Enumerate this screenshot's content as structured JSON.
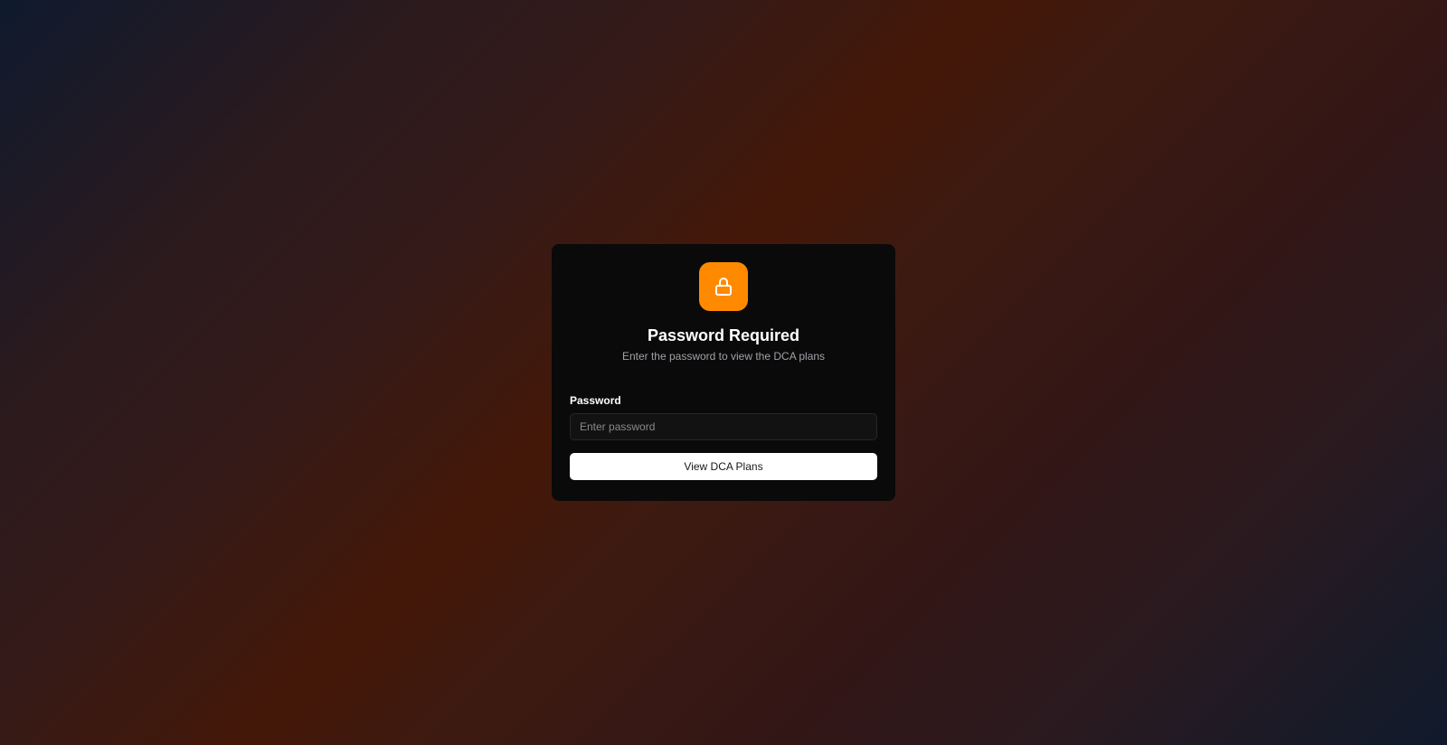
{
  "dialog": {
    "icon": "lock-icon",
    "title": "Password Required",
    "subtitle": "Enter the password to view the DCA plans",
    "password_label": "Password",
    "password_placeholder": "Enter password",
    "password_value": "",
    "submit_label": "View DCA Plans"
  },
  "colors": {
    "accent": "#ff8a00",
    "card_background": "#0a0a0a",
    "button_background": "#ffffff"
  }
}
